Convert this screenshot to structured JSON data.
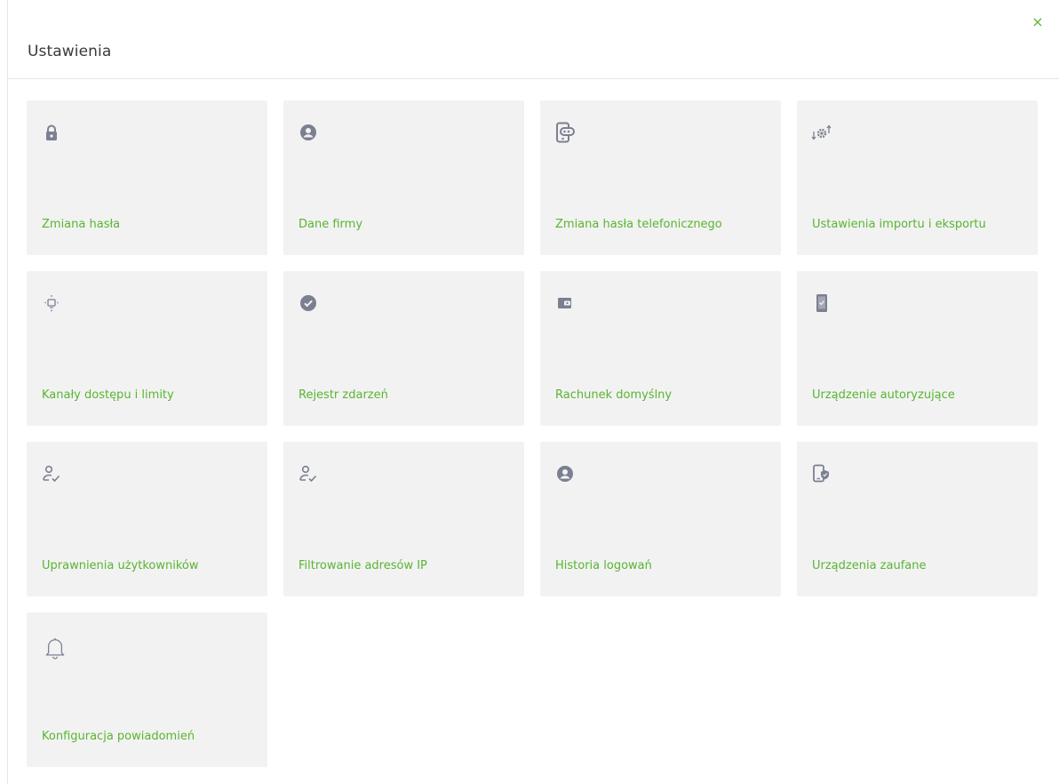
{
  "header": {
    "title": "Ustawienia",
    "close_label": "×"
  },
  "tiles": [
    {
      "label": "Zmiana hasła",
      "icon": "lock-icon"
    },
    {
      "label": "Dane firmy",
      "icon": "user-circle-icon"
    },
    {
      "label": "Zmiana hasła telefonicznego",
      "icon": "phone-password-icon"
    },
    {
      "label": "Ustawienia importu i eksportu",
      "icon": "gear-arrows-icon"
    },
    {
      "label": "Kanały dostępu i limity",
      "icon": "device-channels-icon"
    },
    {
      "label": "Rejestr zdarzeń",
      "icon": "check-circle-icon"
    },
    {
      "label": "Rachunek domyślny",
      "icon": "wallet-icon"
    },
    {
      "label": "Urządzenie autoryzujące",
      "icon": "mobile-device-icon"
    },
    {
      "label": "Uprawnienia użytkowników",
      "icon": "user-check-icon"
    },
    {
      "label": "Filtrowanie adresów IP",
      "icon": "user-check-icon"
    },
    {
      "label": "Historia logowań",
      "icon": "user-circle-icon"
    },
    {
      "label": "Urządzenia zaufane",
      "icon": "trusted-device-icon"
    },
    {
      "label": "Konfiguracja powiadomień",
      "icon": "bell-icon"
    }
  ],
  "colors": {
    "accent": "#59b52f",
    "icon": "#7b8090",
    "tile_bg": "#f2f2f3"
  }
}
